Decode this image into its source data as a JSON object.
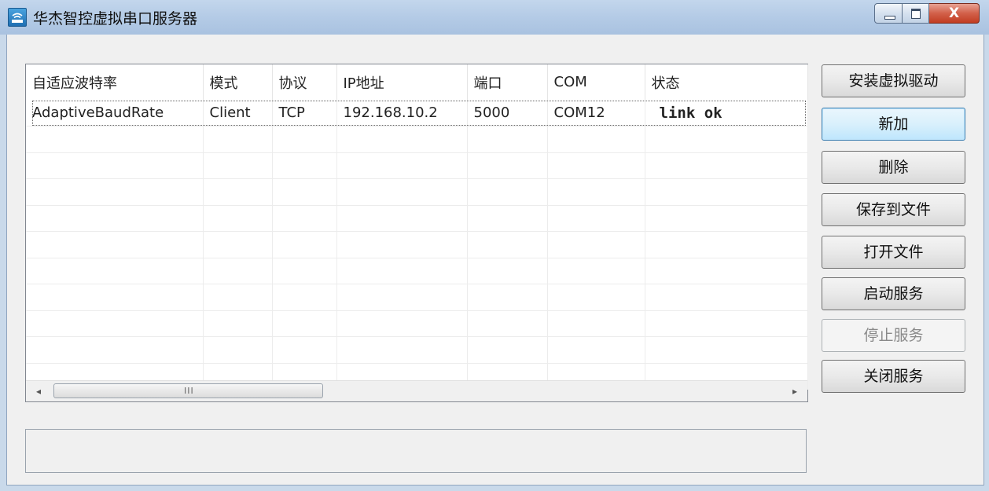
{
  "window": {
    "title": "华杰智控虚拟串口服务器",
    "close_label": "X"
  },
  "table": {
    "columns": [
      "自适应波特率",
      "模式",
      "协议",
      "IP地址",
      "端口",
      "COM",
      "状态"
    ],
    "rows": [
      [
        "AdaptiveBaudRate",
        "Client",
        "TCP",
        "192.168.10.2",
        "5000",
        "COM12",
        "link ok"
      ]
    ],
    "empty_rows": 10
  },
  "scrollbar": {
    "left_arrow": "◂",
    "right_arrow": "▸",
    "grip": "III"
  },
  "buttons": {
    "install_driver": "安装虚拟驱动",
    "add": "新加",
    "delete": "删除",
    "save_to_file": "保存到文件",
    "open_file": "打开文件",
    "start_service": "启动服务",
    "stop_service": "停止服务",
    "close_service": "关闭服务"
  }
}
